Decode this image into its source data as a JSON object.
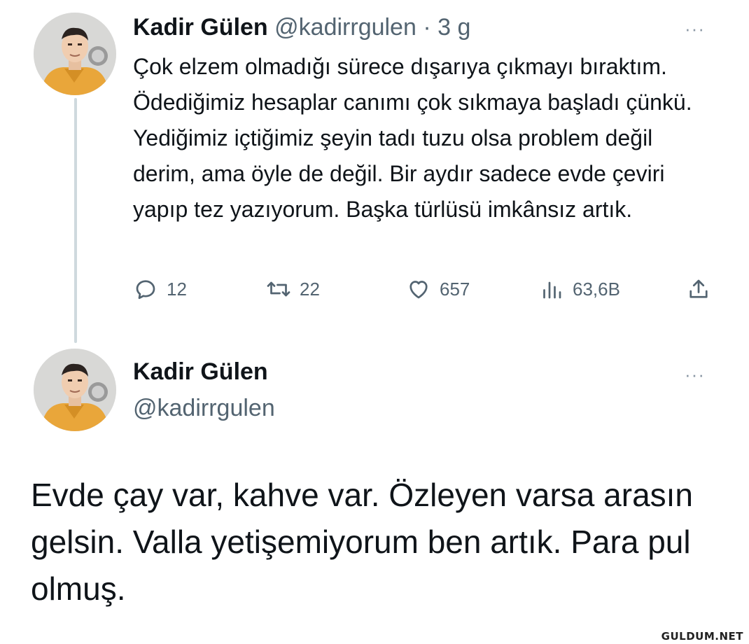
{
  "tweet1": {
    "author_name": "Kadir Gülen",
    "author_handle": "@kadirrgulen",
    "separator": "·",
    "time": "3 g",
    "more_label": "···",
    "text": "Çok elzem olmadığı sürece dışarıya çıkmayı bıraktım. Ödediğimiz hesaplar canımı çok sıkmaya başladı çünkü. Yediğimiz içtiğimiz şeyin tadı tuzu olsa problem değil derim, ama öyle de değil. Bir aydır sadece evde çeviri yapıp tez yazıyorum. Başka türlüsü imkânsız artık.",
    "actions": {
      "replies": "12",
      "retweets": "22",
      "likes": "657",
      "views": "63,6B"
    },
    "icons": [
      "reply-icon",
      "retweet-icon",
      "like-icon",
      "views-icon",
      "share-icon"
    ]
  },
  "tweet2": {
    "author_name": "Kadir Gülen",
    "author_handle": "@kadirrgulen",
    "more_label": "···",
    "text": "Evde çay var, kahve var. Özleyen varsa arasın gelsin. Valla yetişemiyorum ben artık. Para pul olmuş."
  },
  "watermark": "GULDUM.NET",
  "colors": {
    "text_primary": "#0f1419",
    "text_secondary": "#536471",
    "thread_line": "#cfd9de",
    "avatar_hoodie": "#e9a63a"
  }
}
